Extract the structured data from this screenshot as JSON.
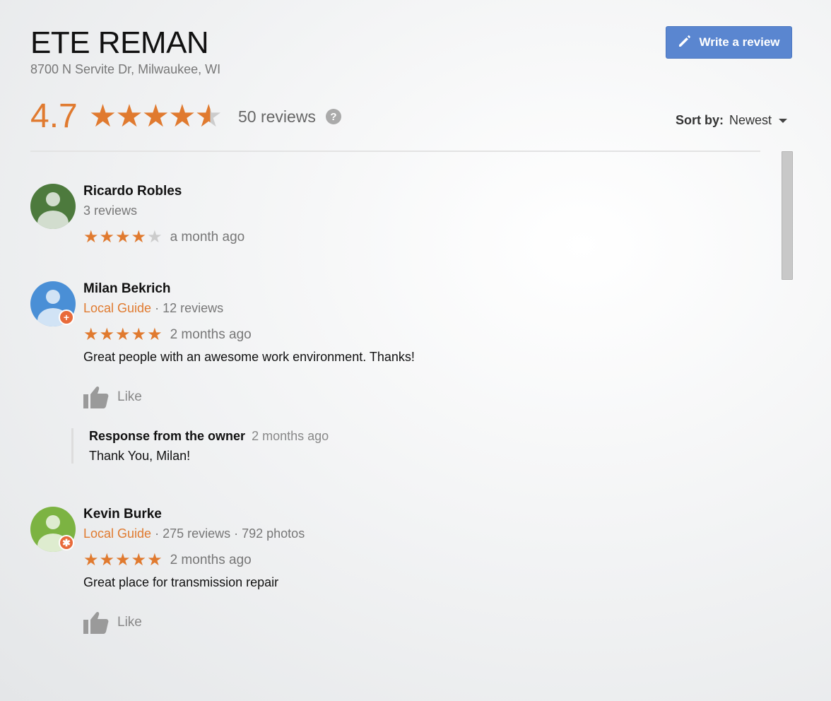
{
  "business": {
    "name": "ETE REMAN",
    "address": "8700 N Servite Dr, Milwaukee, WI"
  },
  "write_review_label": "Write a review",
  "summary": {
    "rating": "4.7",
    "rating_value": 4.7,
    "reviews_count": "50 reviews",
    "help_glyph": "?"
  },
  "sort": {
    "label": "Sort by:",
    "value": "Newest"
  },
  "colors": {
    "star_accent": "#e07a2f",
    "button_blue": "#5a86d0"
  },
  "reviews": [
    {
      "name": "Ricardo Robles",
      "local_guide": "",
      "meta": "3 reviews",
      "stars": 4,
      "time": "a month ago",
      "text": "",
      "avatar_color": "#4d7a3d"
    },
    {
      "name": "Milan Bekrich",
      "local_guide": "Local Guide",
      "meta": " · 12 reviews",
      "stars": 5,
      "time": "2 months ago",
      "text": "Great people with an awesome work environment. Thanks!",
      "like_label": "Like",
      "avatar_color": "#4a8fd6",
      "response": {
        "label": "Response from the owner",
        "time": "2 months ago",
        "text": "Thank You, Milan!"
      }
    },
    {
      "name": "Kevin Burke",
      "local_guide": "Local Guide",
      "meta": " · 275 reviews · 792 photos",
      "stars": 5,
      "time": "2 months ago",
      "text": "Great place for transmission repair",
      "like_label": "Like",
      "avatar_color": "#7cb342"
    }
  ]
}
